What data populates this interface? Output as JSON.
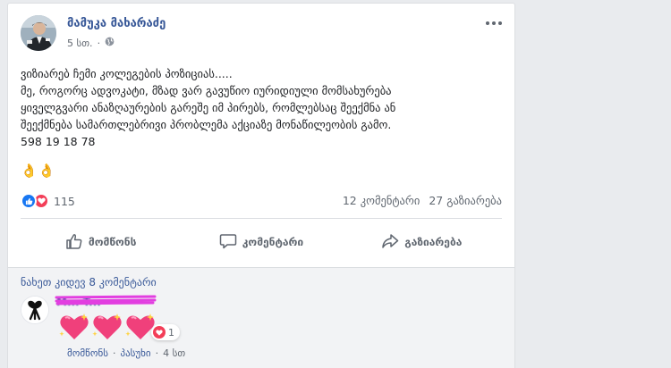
{
  "post": {
    "author": "მამუკა მახარაძე",
    "time": "5 სთ.",
    "privacy_icon": "globe-icon",
    "lines": [
      "ვიზიარებ ჩემი კოლეგების პოზიციას.....",
      "მე, როგორც ადვოკატი, მზად ვარ გავუწიო იურიდიული მომსახურება",
      "ყიველგვარი ანაზღაურების გარეშე იმ პირებს, რომლებსაც შეექმნა ან",
      "შეექმნება სამართლებრივი პრობლემა აქციაზე მონაწილეობის გამო.",
      "598 19 18 78"
    ],
    "emojis": "👌👌",
    "reaction_count": "115",
    "comments_count": "12 კომენტარი",
    "shares_count": "27 გაზიარება"
  },
  "actions": {
    "like": "მომწონს",
    "comment": "კომენტარი",
    "share": "გაზიარება"
  },
  "comments": {
    "view_more": "ნახეთ კიდევ 8 კომენტარი",
    "first": {
      "author": "M... T...",
      "content_emojis": "💖💖💖",
      "reaction_count": "1",
      "like_label": "მომწონს",
      "reply_label": "პასუხი",
      "time": "4 სთ"
    }
  },
  "colors": {
    "link": "#385898",
    "like_blue": "#1877f2",
    "love_red": "#f33e58"
  }
}
